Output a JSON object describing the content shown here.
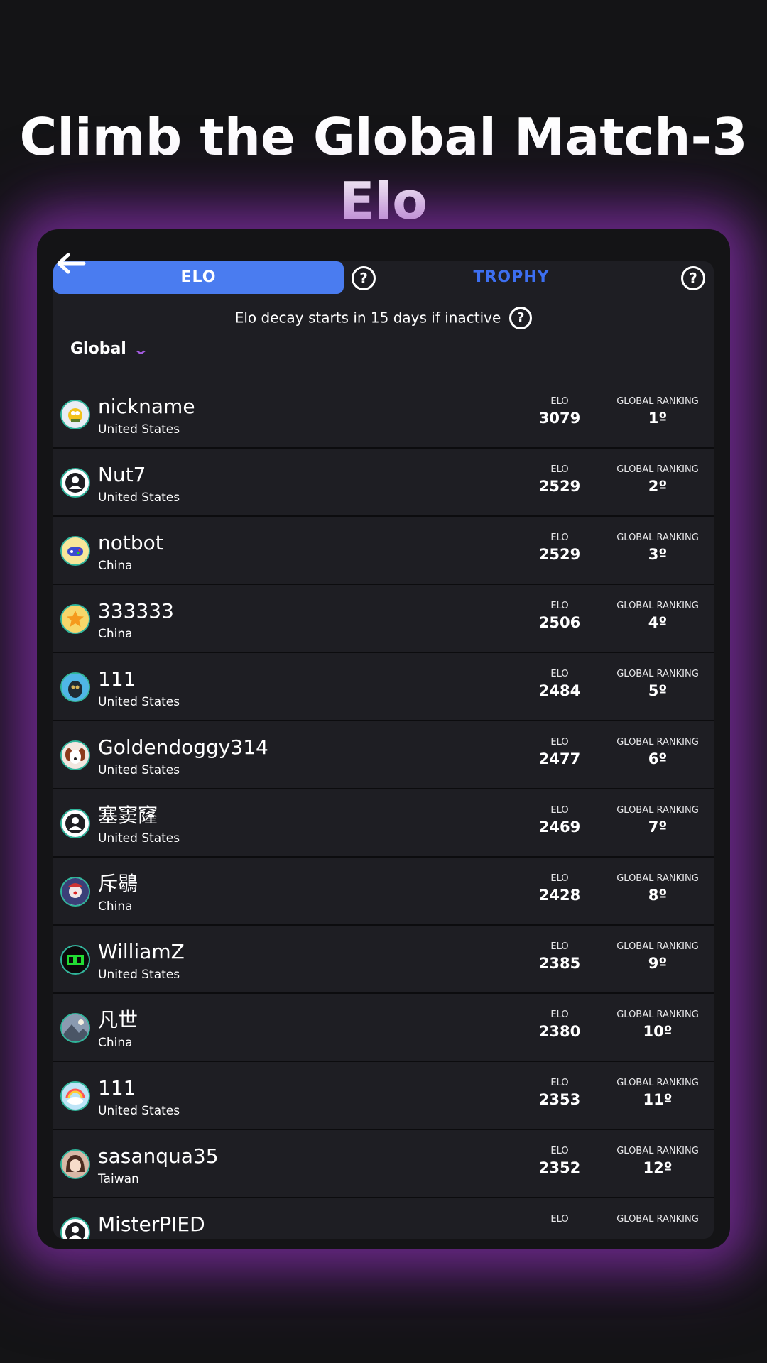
{
  "headline": "Climb the Global Match-3 Elo",
  "tabs": {
    "elo_label": "ELO",
    "trophy_label": "TROPHY"
  },
  "decay_notice": "Elo decay starts in 15 days if inactive",
  "region_filter": "Global",
  "stat_labels": {
    "elo": "ELO",
    "ranking": "GLOBAL RANKING"
  },
  "icons": {
    "back": "back-arrow-icon",
    "help": "question-circle-icon",
    "dropdown": "chevron-down-icon"
  },
  "colors": {
    "active_tab": "#4a7cf0",
    "inactive_tab_text": "#3d6ff0",
    "dropdown_chevron": "#a45be0",
    "glow": "#9637be"
  },
  "players": [
    {
      "name": "nickname",
      "country": "United States",
      "elo": "3079",
      "rank": "1º",
      "avatar": "cartoon-character-avatar"
    },
    {
      "name": "Nut7",
      "country": "United States",
      "elo": "2529",
      "rank": "2º",
      "avatar": "default-user-avatar"
    },
    {
      "name": "notbot",
      "country": "China",
      "elo": "2529",
      "rank": "3º",
      "avatar": "gamepad-avatar"
    },
    {
      "name": "333333",
      "country": "China",
      "elo": "2506",
      "rank": "4º",
      "avatar": "star-avatar"
    },
    {
      "name": "111",
      "country": "United States",
      "elo": "2484",
      "rank": "5º",
      "avatar": "penguin-avatar"
    },
    {
      "name": "Goldendoggy314",
      "country": "United States",
      "elo": "2477",
      "rank": "6º",
      "avatar": "dog-avatar"
    },
    {
      "name": "塞窦窿",
      "country": "United States",
      "elo": "2469",
      "rank": "7º",
      "avatar": "default-user-avatar"
    },
    {
      "name": "斥鶡",
      "country": "China",
      "elo": "2428",
      "rank": "8º",
      "avatar": "clown-avatar"
    },
    {
      "name": "WilliamZ",
      "country": "United States",
      "elo": "2385",
      "rank": "9º",
      "avatar": "green-text-avatar"
    },
    {
      "name": "凡世",
      "country": "China",
      "elo": "2380",
      "rank": "10º",
      "avatar": "landscape-avatar"
    },
    {
      "name": "111",
      "country": "United States",
      "elo": "2353",
      "rank": "11º",
      "avatar": "rainbow-cloud-avatar"
    },
    {
      "name": "sasanqua35",
      "country": "Taiwan",
      "elo": "2352",
      "rank": "12º",
      "avatar": "anime-girl-avatar"
    },
    {
      "name": "MisterPIED",
      "country": "",
      "elo": "",
      "rank": "",
      "avatar": "default-user-avatar"
    }
  ]
}
